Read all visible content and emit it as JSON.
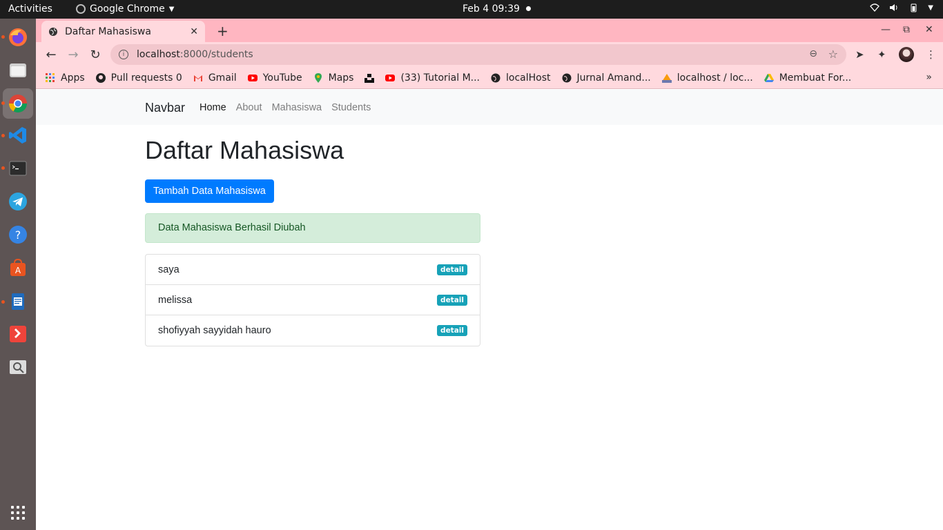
{
  "topbar": {
    "activities": "Activities",
    "app_name": "Google Chrome",
    "datetime": "Feb 4  09:39"
  },
  "browser": {
    "tab_title": "Daftar Mahasiswa",
    "url_host": "localhost",
    "url_path": ":8000/students",
    "bookmarks": [
      {
        "label": "Apps",
        "icon": "apps-grid-icon"
      },
      {
        "label": "Pull requests 0",
        "icon": "github-icon"
      },
      {
        "label": "Gmail",
        "icon": "gmail-icon"
      },
      {
        "label": "YouTube",
        "icon": "youtube-icon"
      },
      {
        "label": "Maps",
        "icon": "maps-pin-icon"
      },
      {
        "label": "",
        "icon": "unsplash-icon"
      },
      {
        "label": "(33) Tutorial M...",
        "icon": "youtube-icon"
      },
      {
        "label": "localHost",
        "icon": "globe-icon"
      },
      {
        "label": "Jurnal Amand...",
        "icon": "globe-icon"
      },
      {
        "label": "localhost / loc...",
        "icon": "phpmyadmin-icon"
      },
      {
        "label": "Membuat For...",
        "icon": "drive-icon"
      }
    ]
  },
  "site": {
    "brand": "Navbar",
    "nav": [
      "Home",
      "About",
      "Mahasiswa",
      "Students"
    ],
    "heading": "Daftar Mahasiswa",
    "add_button": "Tambah Data Mahasiswa",
    "alert": "Data Mahasiswa Berhasil Diubah",
    "students": [
      {
        "name": "saya",
        "badge": "detail"
      },
      {
        "name": "melissa",
        "badge": "detail"
      },
      {
        "name": "shofiyyah sayyidah hauro",
        "badge": "detail"
      }
    ]
  },
  "colors": {
    "primary": "#007bff",
    "alert_bg": "#d4edda",
    "badge": "#17a2b8",
    "tabstrip": "#ffb6c1"
  }
}
